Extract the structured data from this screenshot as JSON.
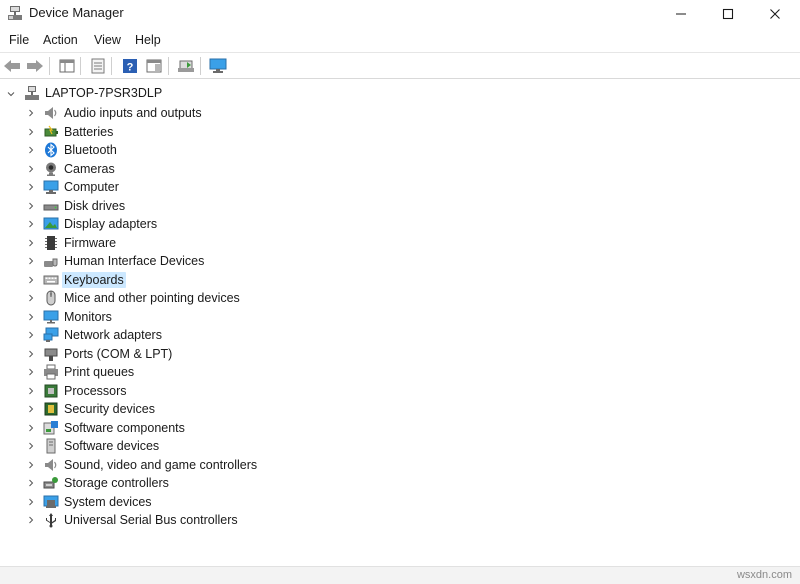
{
  "window": {
    "title": "Device Manager",
    "icon": "device-manager-icon"
  },
  "menu": [
    "File",
    "Action",
    "View",
    "Help"
  ],
  "toolbar": {
    "buttons": [
      "back-arrow-icon",
      "forward-arrow-icon",
      "show-hide-console-tree-icon",
      "properties-icon",
      "help-icon",
      "action-pane-icon",
      "update-driver-icon",
      "scan-hardware-changes-icon"
    ]
  },
  "tree": {
    "root": "LAPTOP-7PSR3DLP",
    "selected": "Keyboards",
    "items": [
      {
        "label": "Audio inputs and outputs",
        "icon": "speaker-icon"
      },
      {
        "label": "Batteries",
        "icon": "battery-icon"
      },
      {
        "label": "Bluetooth",
        "icon": "bluetooth-icon"
      },
      {
        "label": "Cameras",
        "icon": "camera-icon"
      },
      {
        "label": "Computer",
        "icon": "computer-icon"
      },
      {
        "label": "Disk drives",
        "icon": "disk-drive-icon"
      },
      {
        "label": "Display adapters",
        "icon": "display-adapter-icon"
      },
      {
        "label": "Firmware",
        "icon": "firmware-icon"
      },
      {
        "label": "Human Interface Devices",
        "icon": "hid-icon"
      },
      {
        "label": "Keyboards",
        "icon": "keyboard-icon"
      },
      {
        "label": "Mice and other pointing devices",
        "icon": "mouse-icon"
      },
      {
        "label": "Monitors",
        "icon": "monitor-icon"
      },
      {
        "label": "Network adapters",
        "icon": "network-adapter-icon"
      },
      {
        "label": "Ports (COM & LPT)",
        "icon": "port-icon"
      },
      {
        "label": "Print queues",
        "icon": "printer-icon"
      },
      {
        "label": "Processors",
        "icon": "processor-icon"
      },
      {
        "label": "Security devices",
        "icon": "security-device-icon"
      },
      {
        "label": "Software components",
        "icon": "software-component-icon"
      },
      {
        "label": "Software devices",
        "icon": "software-device-icon"
      },
      {
        "label": "Sound, video and game controllers",
        "icon": "sound-controller-icon"
      },
      {
        "label": "Storage controllers",
        "icon": "storage-controller-icon"
      },
      {
        "label": "System devices",
        "icon": "system-device-icon"
      },
      {
        "label": "Universal Serial Bus controllers",
        "icon": "usb-icon"
      }
    ]
  },
  "watermark": "wsxdn.com",
  "colors": {
    "selection": "#cce8ff",
    "help_blue": "#2b5fb3",
    "monitor_blue": "#3aa0e8"
  }
}
